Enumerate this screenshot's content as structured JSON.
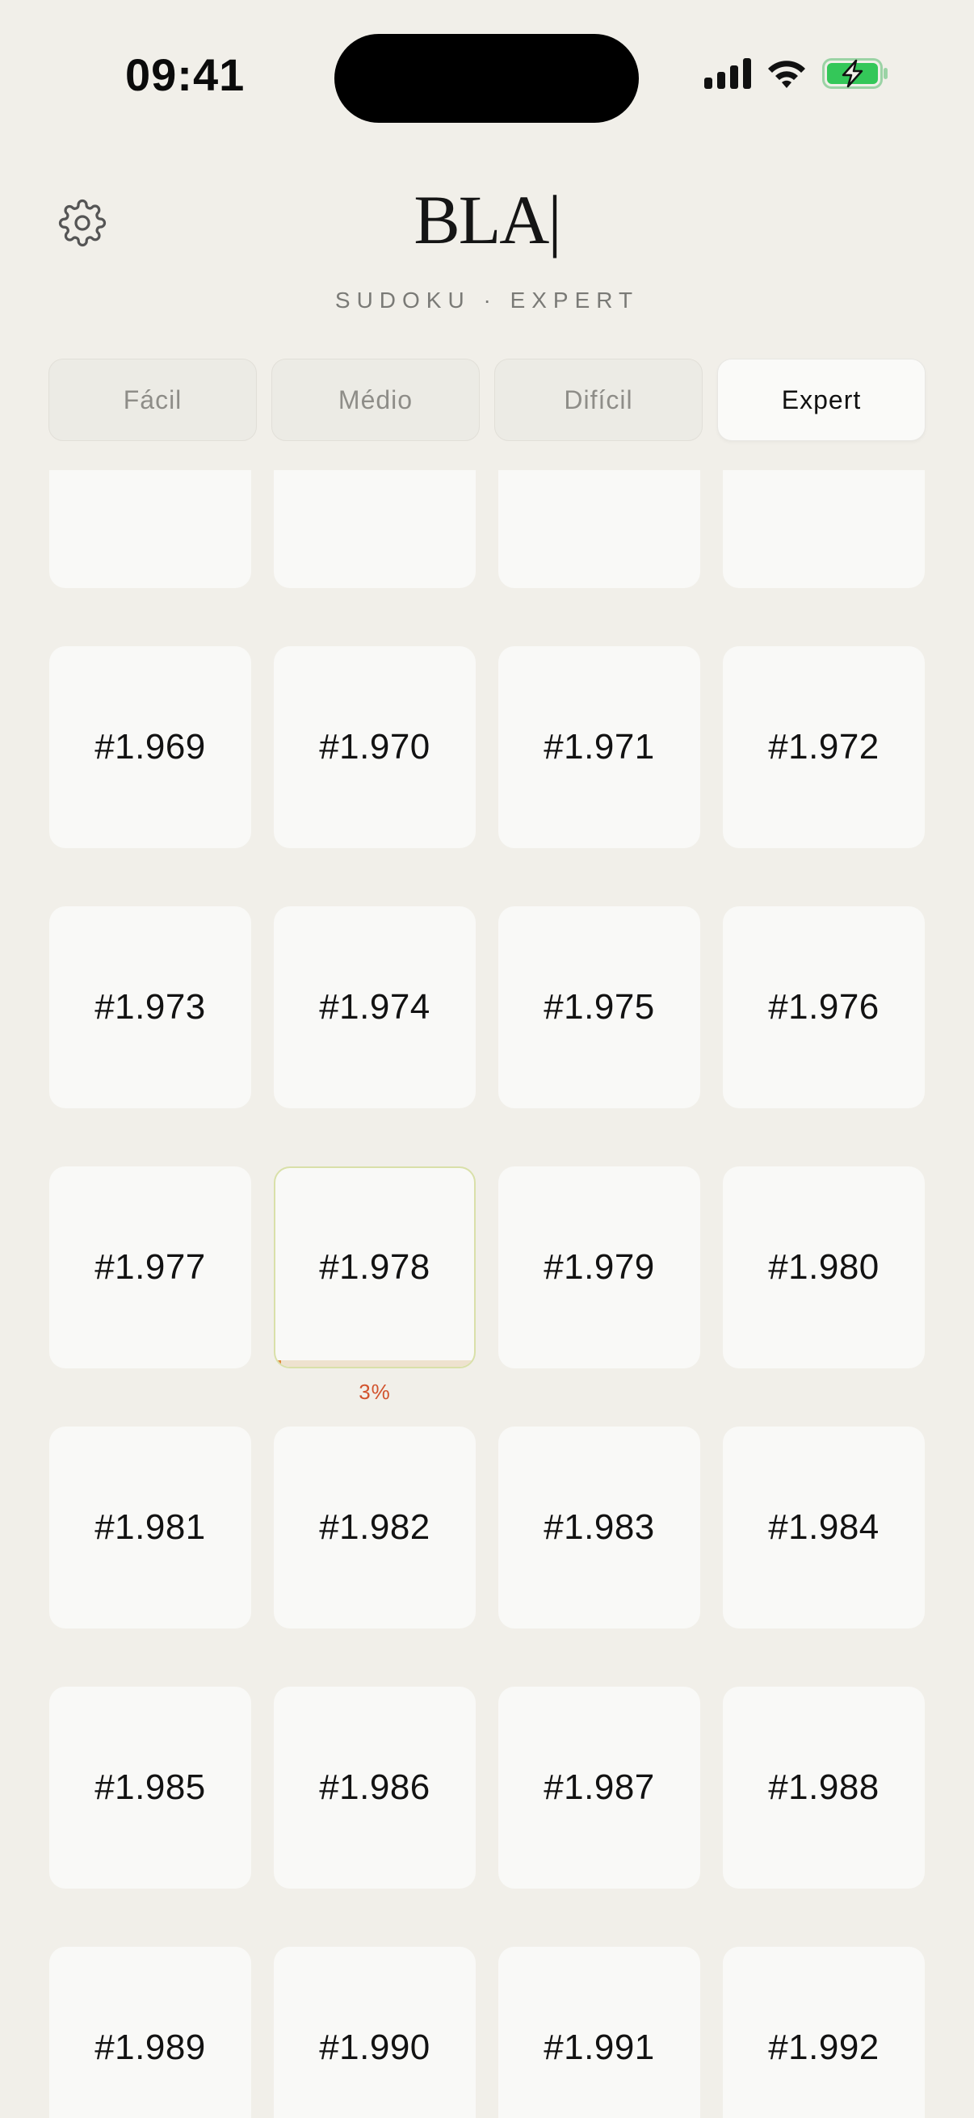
{
  "status_bar": {
    "time": "09:41",
    "icons": [
      "signal-icon",
      "wifi-icon",
      "battery-charging-icon"
    ],
    "battery_color": "#34c759"
  },
  "header": {
    "settings_icon": "gear-icon",
    "logo": "BLA|",
    "subtitle": "SUDOKU · EXPERT"
  },
  "tabs": [
    {
      "label": "Fácil",
      "active": false
    },
    {
      "label": "Médio",
      "active": false
    },
    {
      "label": "Difícil",
      "active": false
    },
    {
      "label": "Expert",
      "active": true
    }
  ],
  "puzzles": [
    {
      "label": ""
    },
    {
      "label": ""
    },
    {
      "label": ""
    },
    {
      "label": ""
    },
    {
      "label": "#1.969"
    },
    {
      "label": "#1.970"
    },
    {
      "label": "#1.971"
    },
    {
      "label": "#1.972"
    },
    {
      "label": "#1.973"
    },
    {
      "label": "#1.974"
    },
    {
      "label": "#1.975"
    },
    {
      "label": "#1.976"
    },
    {
      "label": "#1.977"
    },
    {
      "label": "#1.978",
      "progress": 0.03,
      "progress_label": "3%"
    },
    {
      "label": "#1.979"
    },
    {
      "label": "#1.980"
    },
    {
      "label": "#1.981"
    },
    {
      "label": "#1.982"
    },
    {
      "label": "#1.983"
    },
    {
      "label": "#1.984"
    },
    {
      "label": "#1.985"
    },
    {
      "label": "#1.986"
    },
    {
      "label": "#1.987"
    },
    {
      "label": "#1.988"
    },
    {
      "label": "#1.989"
    },
    {
      "label": "#1.990"
    },
    {
      "label": "#1.991"
    },
    {
      "label": "#1.992"
    }
  ],
  "colors": {
    "background": "#f1efe9",
    "card": "#f9f9f7",
    "progress_text": "#d2532d",
    "in_progress_border": "#d9e0a9"
  }
}
